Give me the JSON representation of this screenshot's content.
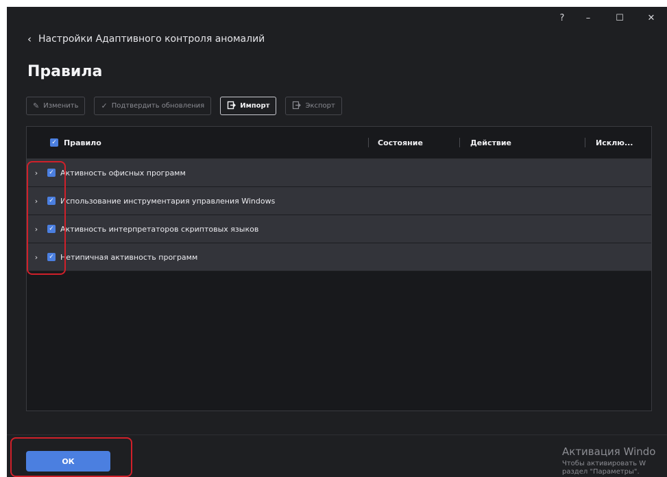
{
  "window": {
    "controls": {
      "help": "?",
      "minimize": "–",
      "maximize": "☐",
      "close": "✕"
    }
  },
  "breadcrumb": {
    "back_icon": "chevron-left-icon",
    "text": "Настройки Адаптивного контроля аномалий"
  },
  "page_title": "Правила",
  "toolbar": {
    "edit": {
      "label": "Изменить",
      "icon": "pencil-icon",
      "enabled": false
    },
    "confirm": {
      "label": "Подтвердить обновления",
      "icon": "check-icon",
      "enabled": false
    },
    "import": {
      "label": "Импорт",
      "icon": "import-icon",
      "enabled": true
    },
    "export": {
      "label": "Экспорт",
      "icon": "export-icon",
      "enabled": false
    }
  },
  "table": {
    "columns": [
      "Правило",
      "Состояние",
      "Действие",
      "Исклю..."
    ],
    "header_checked": true,
    "rows": [
      {
        "name": "Активность офисных программ",
        "checked": true
      },
      {
        "name": "Использование инструментария управления Windows",
        "checked": true
      },
      {
        "name": "Активность интерпретаторов скриптовых языков",
        "checked": true
      },
      {
        "name": "Нетипичная активность программ",
        "checked": true
      }
    ]
  },
  "footer": {
    "ok_label": "ОК"
  },
  "watermark": {
    "line1": "Активация Windo",
    "line2": "Чтобы активировать W",
    "line3": "раздел \"Параметры\"."
  },
  "colors": {
    "accent": "#4b7fe0",
    "window_bg": "#1e1f22",
    "row_bg": "#33343a",
    "annotation": "#d1202a"
  }
}
